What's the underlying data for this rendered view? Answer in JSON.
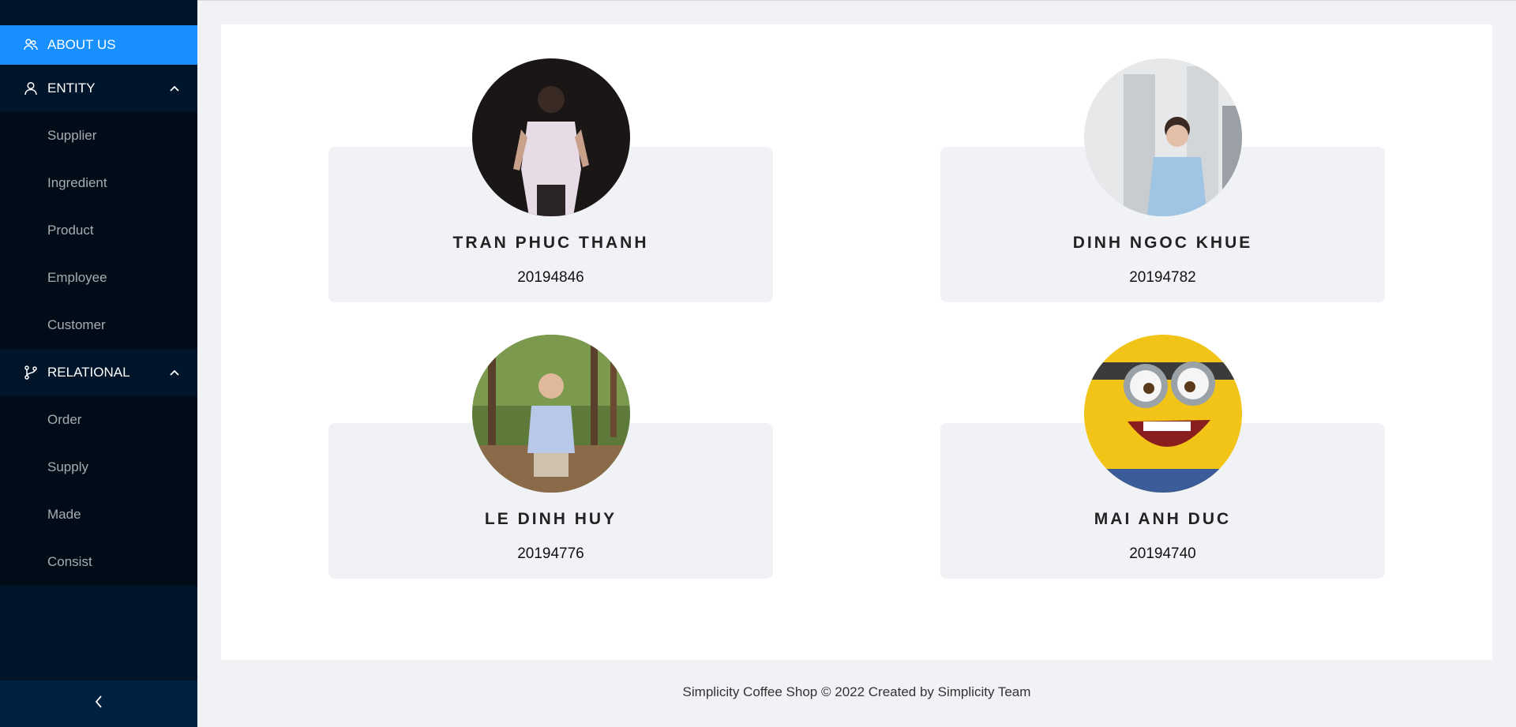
{
  "sidebar": {
    "about": {
      "label": "ABOUT US",
      "icon": "team-icon"
    },
    "entity": {
      "label": "ENTITY",
      "icon": "user-icon",
      "items": [
        "Supplier",
        "Ingredient",
        "Product",
        "Employee",
        "Customer"
      ]
    },
    "relational": {
      "label": "RELATIONAL",
      "icon": "branch-icon",
      "items": [
        "Order",
        "Supply",
        "Made",
        "Consist"
      ]
    },
    "collapse_icon": "chevron-left-icon"
  },
  "members": [
    {
      "name": "TRAN PHUC THANH",
      "id": "20194846"
    },
    {
      "name": "DINH NGOC KHUE",
      "id": "20194782"
    },
    {
      "name": "LE DINH HUY",
      "id": "20194776"
    },
    {
      "name": "MAI ANH DUC",
      "id": "20194740"
    }
  ],
  "footer": {
    "text": "Simplicity Coffee Shop © 2022 Created by Simplicity Team"
  },
  "colors": {
    "sidebar_bg": "#001529",
    "submenu_bg": "#000c17",
    "active": "#1890ff"
  }
}
